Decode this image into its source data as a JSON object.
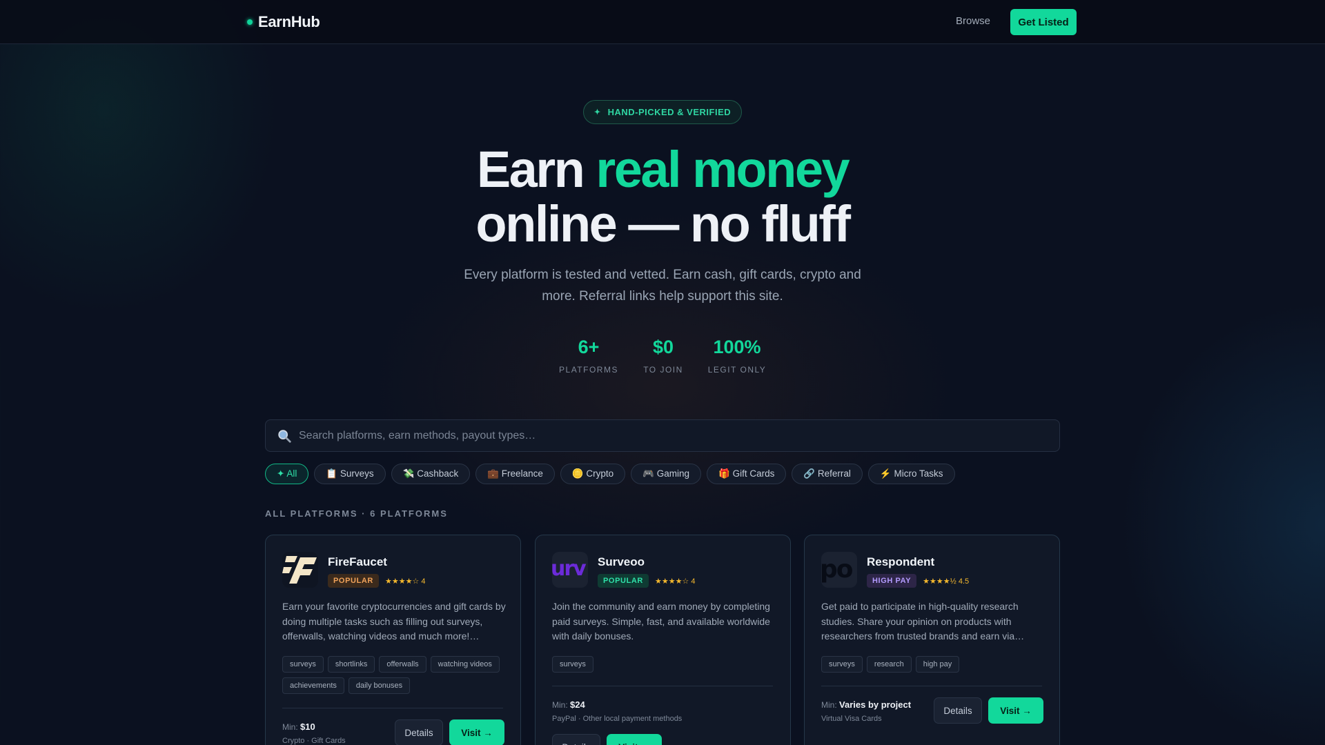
{
  "nav": {
    "brand": "EarnHub",
    "browse": "Browse",
    "cta": "Get Listed"
  },
  "hero": {
    "pill_icon": "sparkle-icon",
    "pill": "HAND-PICKED & VERIFIED",
    "title_part1": "Earn ",
    "title_accent": "real money",
    "title_part2": "online — no fluff",
    "subtitle": "Every platform is tested and vetted. Earn cash, gift cards, crypto and more. Referral links help support this site."
  },
  "stats": [
    {
      "value": "6+",
      "label": "PLATFORMS"
    },
    {
      "value": "$0",
      "label": "TO JOIN"
    },
    {
      "value": "100%",
      "label": "LEGIT ONLY"
    }
  ],
  "search": {
    "icon": "search-icon",
    "placeholder": "Search platforms, earn methods, payout types…"
  },
  "filters": [
    {
      "label": "✦ All",
      "active": true
    },
    {
      "label": "📋 Surveys"
    },
    {
      "label": "💸 Cashback"
    },
    {
      "label": "💼 Freelance"
    },
    {
      "label": "🪙 Crypto"
    },
    {
      "label": "🎮 Gaming"
    },
    {
      "label": "🎁 Gift Cards"
    },
    {
      "label": "🔗 Referral"
    },
    {
      "label": "⚡ Micro Tasks"
    }
  ],
  "section_label": "ALL PLATFORMS · 6 PLATFORMS",
  "cards": [
    {
      "name": "FireFaucet",
      "badge": "POPULAR",
      "rating": "★★★★☆ 4",
      "description": "Earn your favorite cryptocurrencies and gift cards by doing multiple tasks such as filling out surveys, offerwalls, watching videos and much more!…",
      "tags": [
        "surveys",
        "shortlinks",
        "offerwalls",
        "watching videos",
        "achievements",
        "daily bonuses"
      ],
      "min_label": "Min:",
      "min_value": "$10",
      "payout": "Crypto · Gift Cards",
      "details": "Details",
      "visit": "Visit →"
    },
    {
      "name": "Surveoo",
      "badge": "POPULAR",
      "rating": "★★★★☆ 4",
      "description": "Join the community and earn money by completing paid surveys. Simple, fast, and available worldwide with daily bonuses.",
      "tags": [
        "surveys"
      ],
      "min_label": "Min:",
      "min_value": "$24",
      "payout": "PayPal · Other local payment methods",
      "details": "Details",
      "visit": "Visit →"
    },
    {
      "name": "Respondent",
      "badge": "HIGH PAY",
      "rating": "★★★★½ 4.5",
      "description": "Get paid to participate in high-quality research studies. Share your opinion on products with researchers from trusted brands and earn via…",
      "tags": [
        "surveys",
        "research",
        "high pay"
      ],
      "min_label": "Min:",
      "min_value": "Varies by project",
      "payout": "Virtual Visa Cards",
      "details": "Details",
      "visit": "Visit →"
    }
  ]
}
